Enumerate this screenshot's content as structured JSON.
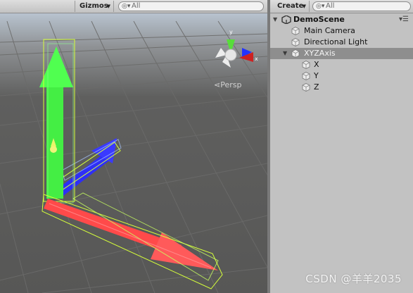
{
  "scene_view": {
    "gizmos_label": "Gizmos",
    "search_placeholder": "All",
    "projection_label": "Persp",
    "axis_labels": {
      "y": "y",
      "x": "x"
    }
  },
  "hierarchy": {
    "create_label": "Create",
    "search_placeholder": "All",
    "scene_name": "DemoScene",
    "items": [
      {
        "label": "Main Camera",
        "depth": 1
      },
      {
        "label": "Directional Light",
        "depth": 1
      },
      {
        "label": "XYZAxis",
        "depth": 1,
        "selected": true,
        "expanded": true
      },
      {
        "label": "X",
        "depth": 2
      },
      {
        "label": "Y",
        "depth": 2
      },
      {
        "label": "Z",
        "depth": 2
      }
    ]
  },
  "watermark": "CSDN @羊羊2035",
  "colors": {
    "x_axis": "#ff4a4a",
    "y_axis": "#44ee44",
    "z_axis": "#2c2cff",
    "selection_outline": "#d6ff3a",
    "scene_background": "#5a5a59",
    "hierarchy_background": "#c2c2c2",
    "hierarchy_selected": "#8e8e8e"
  },
  "icons": [
    "search-icon",
    "unity-scene-icon",
    "hierarchy-menu-icon",
    "cube-icon",
    "orientation-gizmo"
  ]
}
